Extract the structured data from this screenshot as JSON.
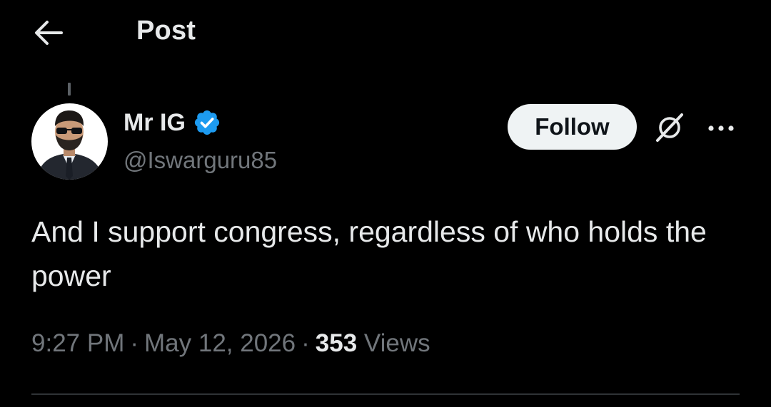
{
  "header": {
    "title": "Post",
    "back_icon": "arrow-left-icon"
  },
  "author": {
    "display_name": "Mr IG",
    "handle": "@Iswarguru85",
    "verified": true,
    "verified_color": "#1d9bf0"
  },
  "actions": {
    "follow_label": "Follow",
    "grok_icon": "grok-icon",
    "more_icon": "more-horizontal-icon"
  },
  "tweet": {
    "text": "And I support congress, regardless of who holds the power"
  },
  "meta": {
    "time": "9:27 PM",
    "separator": "·",
    "date": "May 12, 2026",
    "views_count": "353",
    "views_label": "Views"
  },
  "colors": {
    "background": "#000000",
    "primary_text": "#e7e9ea",
    "secondary_text": "#71767b",
    "divider": "#2f3336",
    "follow_bg": "#eff3f4"
  }
}
